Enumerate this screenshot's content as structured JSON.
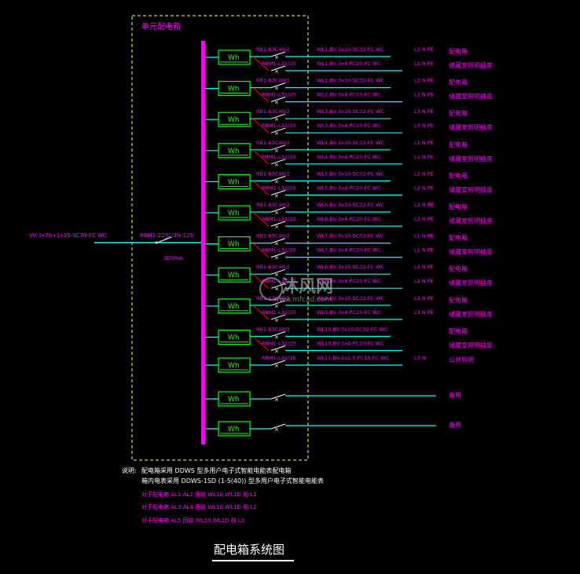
{
  "colors": {
    "bg": "#000000",
    "magenta": "#ff00ff",
    "cyan": "#00ffff",
    "green": "#00ff00",
    "yellow": "#ffff66",
    "red": "#ff0000",
    "white": "#ffffff"
  },
  "box_label": "单元配电箱",
  "meter_label": "Wh",
  "incoming": {
    "cable": "VV-3x70+1x35-SC70-FC WC",
    "breaker": "RBM1-225L/3N-125",
    "rcd": "300mA"
  },
  "circuits": [
    {
      "breaker": "RB1-63C40/2",
      "cable": "WL1,BV-3x10-SC32-FC WC",
      "phase": "L1 N PE",
      "name": "配电箱",
      "sub_breaker": "RBM1-L32/20",
      "sub_cable": "WL1,BV-3x4-PC20-FC WC",
      "sub_phase": "L1 N PE",
      "sub_name": "储藏室照明插座"
    },
    {
      "breaker": "RB1-63C40/2",
      "cable": "WL2,BV-3x10-SC32-FC WC",
      "phase": "L2 N PE",
      "name": "配电箱",
      "sub_breaker": "RBM1-L32/20",
      "sub_cable": "WL2,BV-3x4-PC20-FC WC",
      "sub_phase": "L2 N PE",
      "sub_name": "储藏室照明插座"
    },
    {
      "breaker": "RB1-63C40/2",
      "cable": "WL3,BV-3x10-SC32-FC WC",
      "phase": "L3 N PE",
      "name": "配电箱",
      "sub_breaker": "RBM1-L32/20",
      "sub_cable": "WL3,BV-3x4-PC20-FC WC",
      "sub_phase": "L3 N PE",
      "sub_name": "储藏室照明插座"
    },
    {
      "breaker": "RB1-63C40/2",
      "cable": "WL4,BV-3x10-SC32-FC WC",
      "phase": "L1 N PE",
      "name": "配电箱",
      "sub_breaker": "RBM1-L32/20",
      "sub_cable": "WL4,BV-3x4-PC20-FC WC",
      "sub_phase": "L1 N PE",
      "sub_name": "储藏室照明插座"
    },
    {
      "breaker": "RB1-63C40/2",
      "cable": "WL5,BV-3x10-SC32-FC WC",
      "phase": "L2 N PE",
      "name": "配电箱",
      "sub_breaker": "RBM1-L32/20",
      "sub_cable": "WL5,BV-3x4-PC20-FC WC",
      "sub_phase": "L2 N PE",
      "sub_name": "储藏室照明插座"
    },
    {
      "breaker": "RB1-63C40/2",
      "cable": "WL6,BV-3x10-SC32-FC WC",
      "phase": "L3 N PE",
      "name": "配电箱",
      "sub_breaker": "RBM1-L32/20",
      "sub_cable": "WL6,BV-3x4-PC20-FC WC",
      "sub_phase": "L3 N PE",
      "sub_name": "储藏室照明插座"
    },
    {
      "breaker": "RB1-63C40/2",
      "cable": "WL7,BV-3x10-SC32-FC WC",
      "phase": "L1 N PE",
      "name": "配电箱",
      "sub_breaker": "RBM1-L32/20",
      "sub_cable": "WL7,BV-3x4-PC20-FC WC",
      "sub_phase": "L1 N PE",
      "sub_name": "储藏室照明插座"
    },
    {
      "breaker": "RB1-63C40/2",
      "cable": "WL8,BV-3x10-SC32-FC WC",
      "phase": "L2 N PE",
      "name": "配电箱",
      "sub_breaker": "RBM1-L32/20",
      "sub_cable": "WL8,BV-3x4-PC20-FC WC",
      "sub_phase": "L2 N PE",
      "sub_name": "储藏室照明插座"
    },
    {
      "breaker": "RB1-63C40/2",
      "cable": "WL9,BV-3x10-SC32-FC WC",
      "phase": "L3 N PE",
      "name": "配电箱",
      "sub_breaker": "RBM1-L32/20",
      "sub_cable": "WL9,BV-3x4-PC20-FC WC",
      "sub_phase": "L3 N PE",
      "sub_name": "储藏室照明插座"
    },
    {
      "breaker": "RB1-63C40/2",
      "cable": "WL10,BV-3x10-SC32-FC WC",
      "phase": "",
      "name": "配电箱",
      "sub_breaker": "RBM1-L32/20",
      "sub_cable": "WL10,BV-3x4-PC20-FC WC",
      "sub_phase": "",
      "sub_name": "储藏室照明插座"
    }
  ],
  "public_circuit": {
    "breaker": "RBM1-L32/16",
    "cable": "WL11,BV-2x2.5-PC16-FC WC",
    "phase": "L3 N",
    "name": "公共照明"
  },
  "spares": [
    "备用",
    "备用"
  ],
  "notes": {
    "heading": "说明:",
    "lines": [
      "配电箱采用  DDWS  型多用户电子式智能电能表配电箱",
      "箱内电表采用  DDWS-1SD  (1-5(40))  型多用户电子式智能电能表",
      "对于配电箱  AL1-AL2  回路     WL10,WL1D   相  L1",
      "对于配电箱  AL3-AL4  回路     WL10,WL1D   相  L2",
      "对于配电箱  AL5  回路     WL10,WL1D   相  L3"
    ]
  },
  "title": "配电箱系统图",
  "watermark": {
    "brand": "沐风网",
    "url": "www.mfcad.com"
  }
}
